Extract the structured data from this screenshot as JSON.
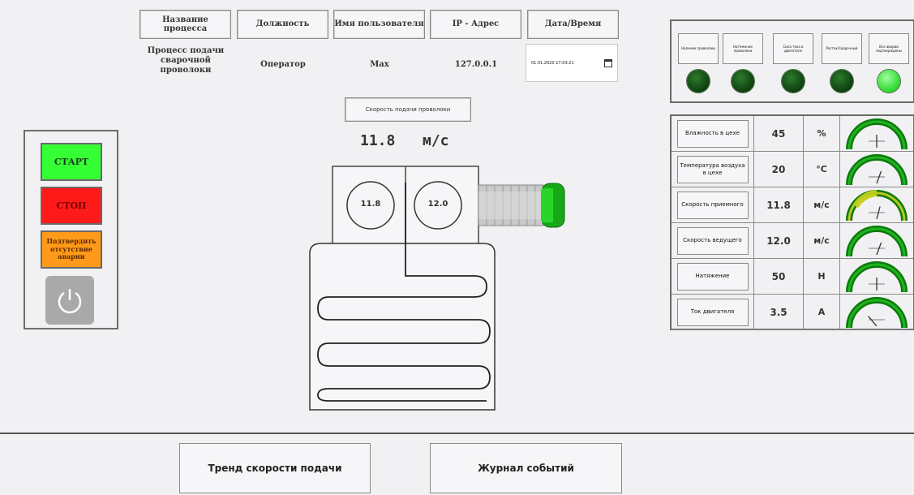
{
  "header": {
    "col_process": "Название процесса",
    "col_position": "Должность",
    "col_user": "Имя пользователя",
    "col_ip": "IP - Адрес",
    "col_datetime": "Дата/Время"
  },
  "info": {
    "process": "Процесс подачи сварочной проволоки",
    "position": "Оператор",
    "user": "Max",
    "ip": "127.0.0.1",
    "datetime": "01.01.2020 17:03:21"
  },
  "speed": {
    "label": "Скорость подачи проволоки",
    "value": "11.8",
    "unit": "м/с"
  },
  "rollers": {
    "left": "11.8",
    "right": "12.0"
  },
  "controls": {
    "start": "СТАРТ",
    "stop": "СТОП",
    "ack": "Подтвердить отсутствие аварии",
    "colors": {
      "start": "#35ff35",
      "stop": "#ff1a1a",
      "ack": "#ff9a1a"
    }
  },
  "indicators": [
    {
      "label": "Наличие проволоки",
      "on": false
    },
    {
      "label": "Натяжение проволоки",
      "on": false
    },
    {
      "label": "Сила тока в двигателе",
      "on": false
    },
    {
      "label": "Росток/Сварочный",
      "on": false
    },
    {
      "label": "Все аварии подтверждены",
      "on": true
    }
  ],
  "params": [
    {
      "label": "Влажность в цехе",
      "value": "45",
      "unit": "%"
    },
    {
      "label": "Температура воздуха в цехе",
      "value": "20",
      "unit": "°C"
    },
    {
      "label": "Скорость приемного",
      "value": "11.8",
      "unit": "м/с"
    },
    {
      "label": "Скорость ведущего",
      "value": "12.0",
      "unit": "м/с"
    },
    {
      "label": "Натяжение",
      "value": "50",
      "unit": "Н"
    },
    {
      "label": "Ток двигателя",
      "value": "3.5",
      "unit": "А"
    }
  ],
  "nav": {
    "trend": "Тренд скорости подачи",
    "journal": "Журнал событий"
  }
}
